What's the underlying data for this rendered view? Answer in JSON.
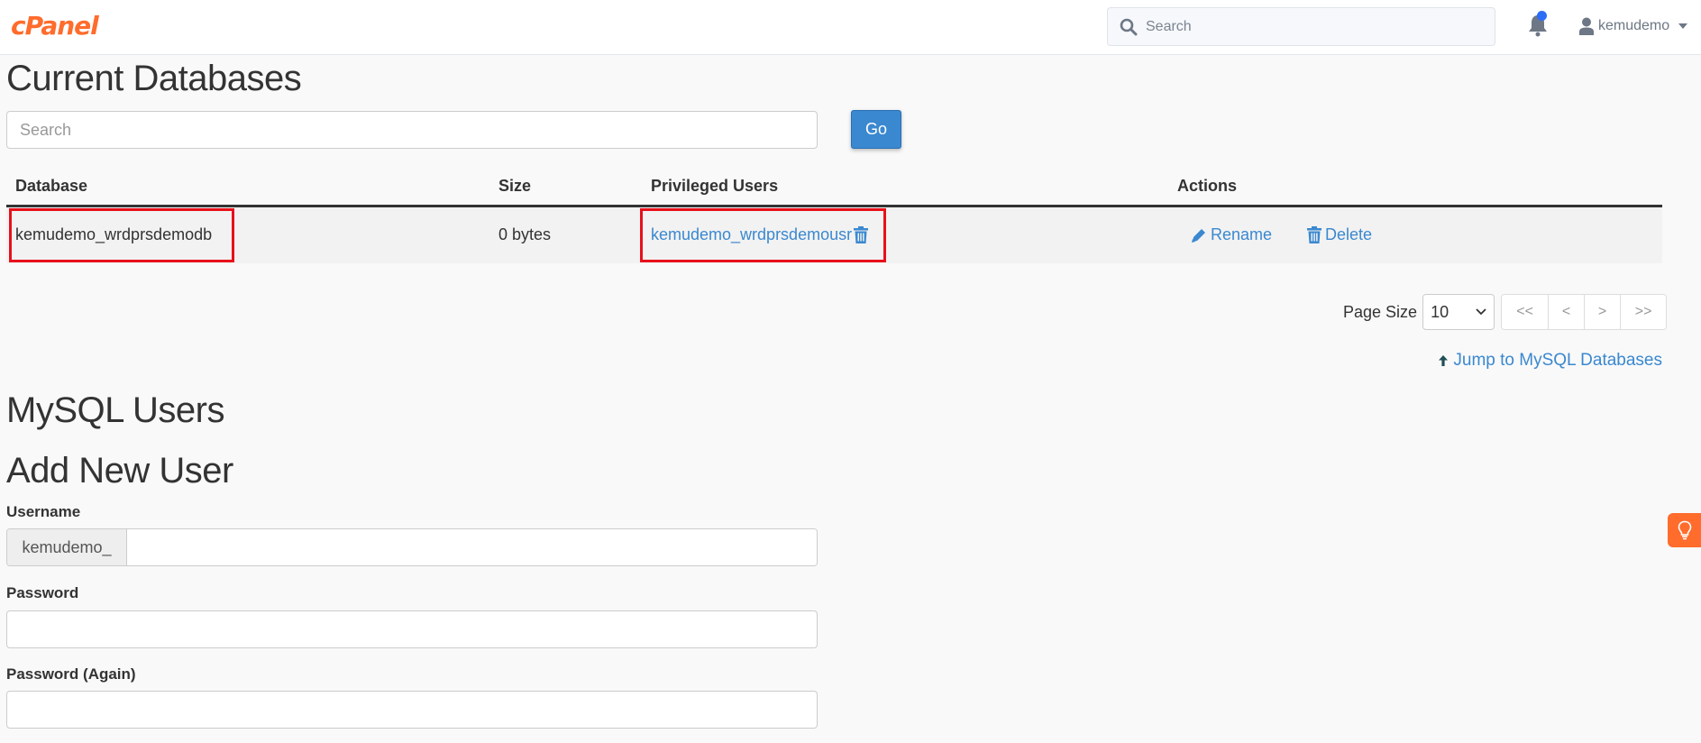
{
  "header": {
    "logo_text": "cPanel",
    "search_placeholder": "Search",
    "notification_icon": "bell-icon",
    "user_icon": "user-icon",
    "username": "kemudemo"
  },
  "current_databases": {
    "title": "Current Databases",
    "search_placeholder": "Search",
    "go_label": "Go",
    "columns": [
      "Database",
      "Size",
      "Privileged Users",
      "Actions"
    ],
    "rows": [
      {
        "database": "kemudemo_wrdprsdemodb",
        "size": "0 bytes",
        "privileged_user": "kemudemo_wrdprsdemousr",
        "actions": [
          "Rename",
          "Delete"
        ]
      }
    ],
    "page_size_label": "Page Size",
    "page_size_value": "10",
    "pager": [
      "<<",
      "<",
      ">",
      ">>"
    ],
    "jump_link": "Jump to MySQL Databases"
  },
  "mysql_users": {
    "title": "MySQL Users",
    "add_title": "Add New User",
    "username_label": "Username",
    "username_prefix": "kemudemo_",
    "username_value": "",
    "password_label": "Password",
    "password_value": "",
    "password_again_label": "Password (Again)",
    "password_again_value": ""
  },
  "colors": {
    "brand": "#ff6c2c",
    "link": "#3a88d0",
    "highlight": "#e8101a",
    "notification_dot": "#2d6cf6"
  }
}
